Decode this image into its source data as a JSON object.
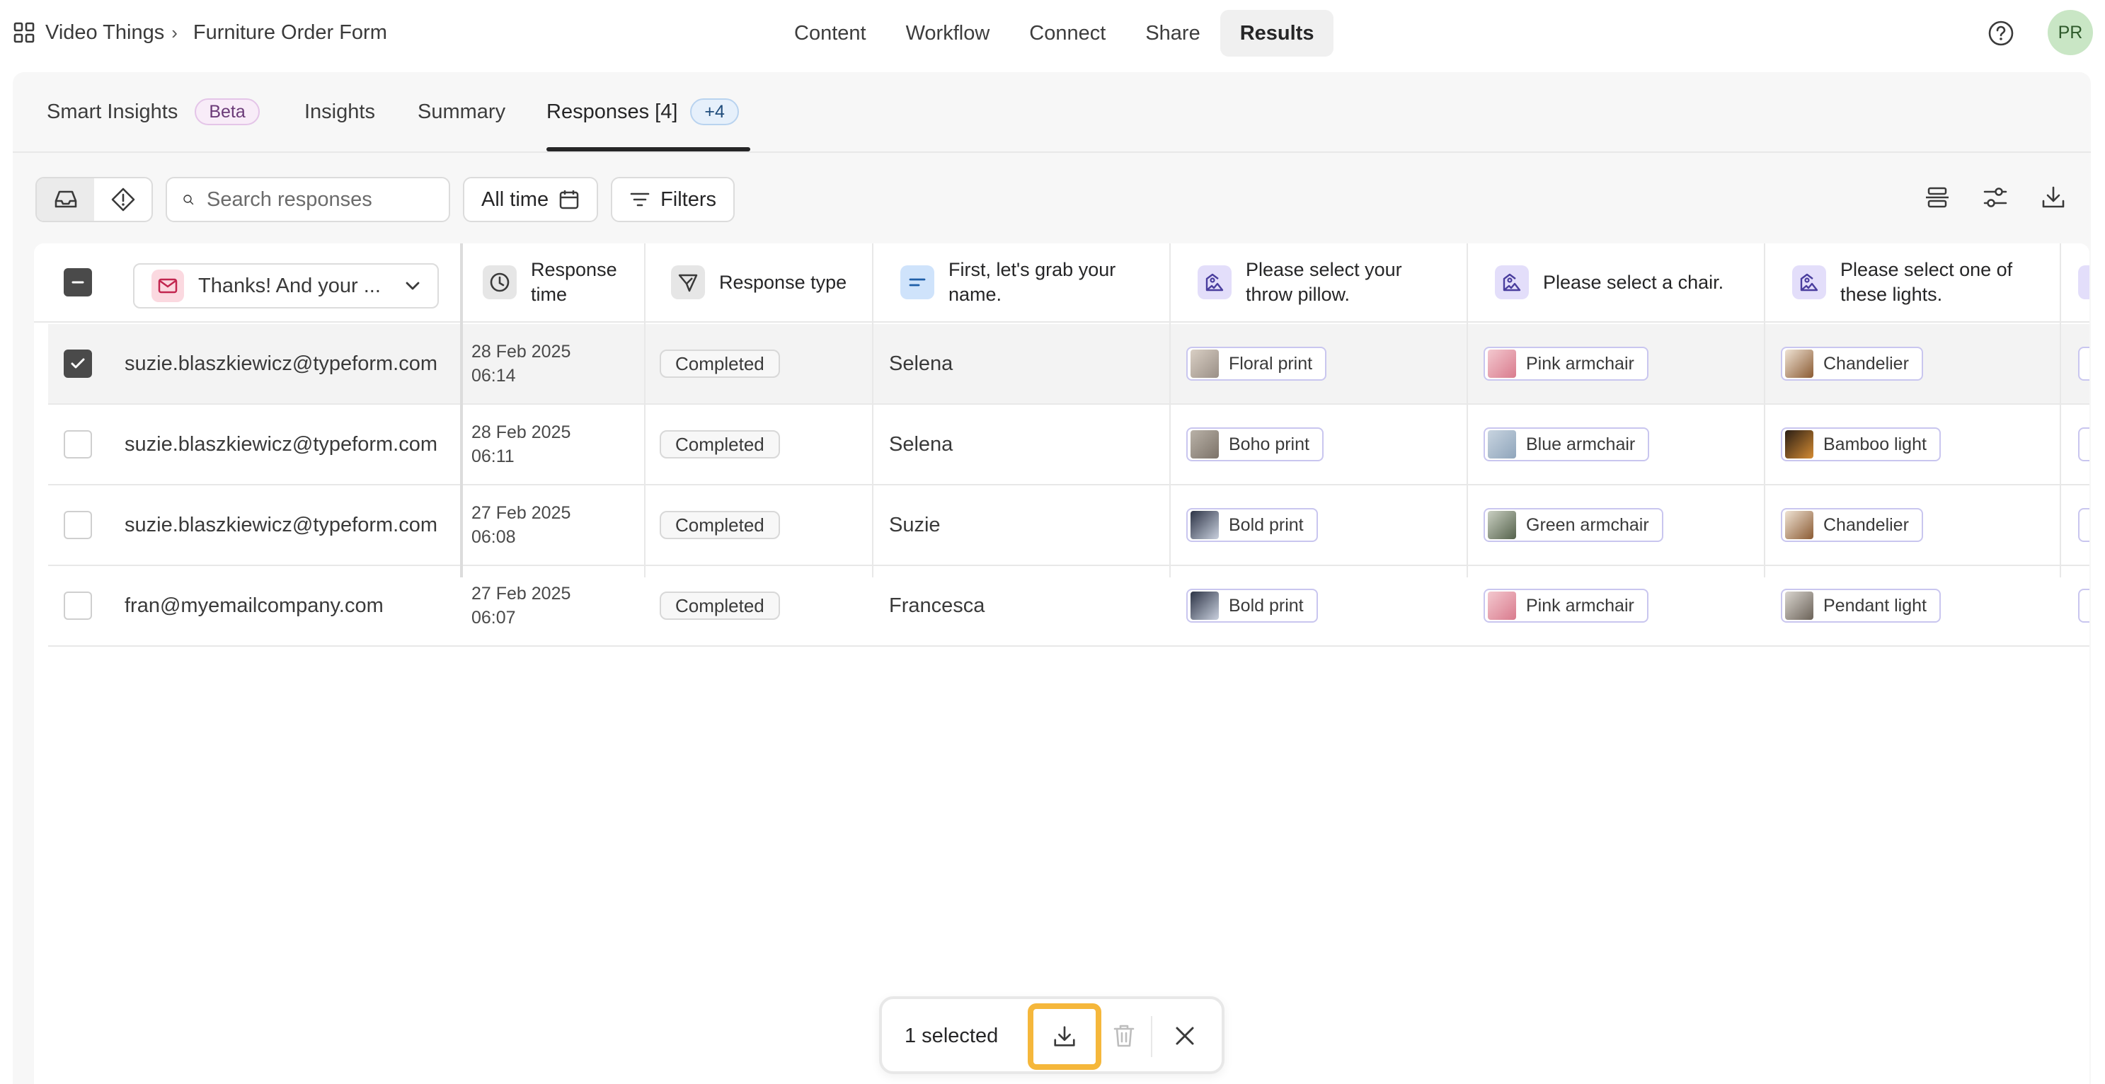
{
  "breadcrumb": {
    "workspace": "Video Things",
    "separator": "›",
    "form": "Furniture Order Form"
  },
  "topnav": [
    {
      "label": "Content",
      "active": false
    },
    {
      "label": "Workflow",
      "active": false
    },
    {
      "label": "Connect",
      "active": false
    },
    {
      "label": "Share",
      "active": false
    },
    {
      "label": "Results",
      "active": true
    }
  ],
  "user": {
    "initials": "PR"
  },
  "tabs": {
    "smart_insights": "Smart Insights",
    "beta": "Beta",
    "insights": "Insights",
    "summary": "Summary",
    "responses": "Responses [4]",
    "responses_badge": "+4"
  },
  "toolbar": {
    "search_placeholder": "Search responses",
    "date_filter": "All time",
    "filters": "Filters"
  },
  "table": {
    "email_column_dropdown": "Thanks! And your ...",
    "headers": {
      "response_time": "Response time",
      "response_type": "Response type",
      "name_q": "First, let's grab your name.",
      "pillow_q": "Please select your throw pillow.",
      "chair_q": "Please select a chair.",
      "light_q": "Please select one of these lights."
    },
    "rows": [
      {
        "email": "suzie.blaszkiewicz@typeform.com",
        "date": "28 Feb 2025",
        "time": "06:14",
        "type": "Completed",
        "name": "Selena",
        "pillow": "Floral print",
        "chair": "Pink armchair",
        "light": "Chandelier",
        "selected": true
      },
      {
        "email": "suzie.blaszkiewicz@typeform.com",
        "date": "28 Feb 2025",
        "time": "06:11",
        "type": "Completed",
        "name": "Selena",
        "pillow": "Boho print",
        "chair": "Blue armchair",
        "light": "Bamboo light",
        "selected": false
      },
      {
        "email": "suzie.blaszkiewicz@typeform.com",
        "date": "27 Feb 2025",
        "time": "06:08",
        "type": "Completed",
        "name": "Suzie",
        "pillow": "Bold print",
        "chair": "Green armchair",
        "light": "Chandelier",
        "selected": false
      },
      {
        "email": "fran@myemailcompany.com",
        "date": "27 Feb 2025",
        "time": "06:07",
        "type": "Completed",
        "name": "Francesca",
        "pillow": "Bold print",
        "chair": "Pink armchair",
        "light": "Pendant light",
        "selected": false
      }
    ]
  },
  "selection_bar": {
    "count_label": "1 selected"
  },
  "colors": {
    "accent_highlight": "#f5b73b",
    "email_icon_bg": "#fbd9e0",
    "name_icon_bg": "#cfe3fb",
    "picture_icon_bg": "#e3defa",
    "avatar_bg": "#c9e6c5"
  }
}
